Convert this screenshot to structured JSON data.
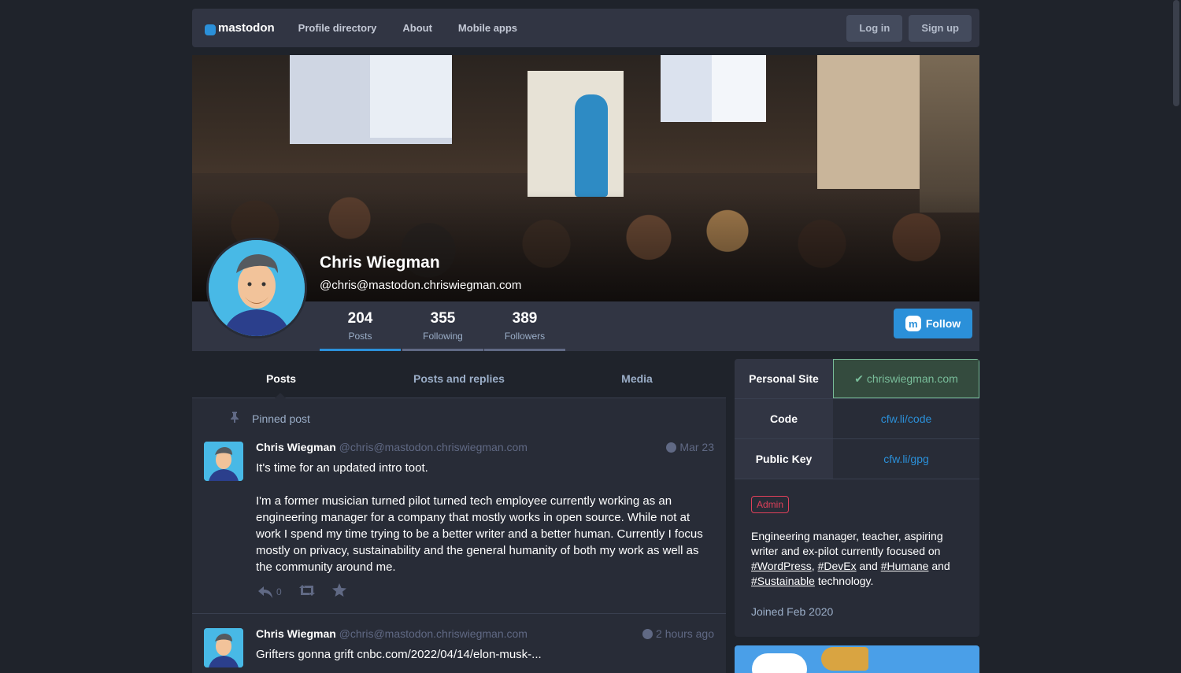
{
  "topbar": {
    "brand": "mastodon",
    "nav": [
      "Profile directory",
      "About",
      "Mobile apps"
    ],
    "login_label": "Log in",
    "signup_label": "Sign up"
  },
  "profile": {
    "name": "Chris Wiegman",
    "handle": "@chris@mastodon.chriswiegman.com",
    "stats": [
      {
        "value": "204",
        "label": "Posts",
        "active": true
      },
      {
        "value": "355",
        "label": "Following",
        "active": false
      },
      {
        "value": "389",
        "label": "Followers",
        "active": false
      }
    ],
    "follow_label": "Follow"
  },
  "tabs": [
    "Posts",
    "Posts and replies",
    "Media"
  ],
  "timeline": {
    "pinned_label": "Pinned post",
    "statuses": [
      {
        "author": "Chris Wiegman",
        "acct": "@chris@mastodon.chriswiegman.com",
        "time": "Mar 23",
        "text1": "It's time for an updated intro toot.",
        "text2": "I'm a former musician turned pilot turned tech employee currently working as an engineering manager for a company that mostly works in open source. While not at work I spend my time trying to be a better writer and a better human. Currently I focus mostly on privacy, sustainability and the general humanity of both my work as well as the community around me.",
        "reply_count": "0"
      },
      {
        "author": "Chris Wiegman",
        "acct": "@chris@mastodon.chriswiegman.com",
        "time": "2 hours ago",
        "text1": "Grifters gonna grift cnbc.com/2022/04/14/elon-musk-..."
      }
    ]
  },
  "sidebar": {
    "fields": [
      {
        "key": "Personal Site",
        "value": "✔ chriswiegman.com",
        "verified": true
      },
      {
        "key": "Code",
        "value": "cfw.li/code",
        "verified": false
      },
      {
        "key": "Public Key",
        "value": "cfw.li/gpg",
        "verified": false
      }
    ],
    "badge": "Admin",
    "bio": {
      "intro": "Engineering manager, teacher, aspiring writer and ex-pilot currently focused on",
      "tag1": "#WordPress",
      "sep1": ",",
      "tag2": "#DevEx",
      "and1": "and",
      "tag3": "#Humane",
      "and2": "and",
      "tag4": "#Sustainable",
      "outro": "technology."
    },
    "joined": "Joined Feb 2020"
  },
  "icons": {
    "pin": "pin-icon",
    "reply": "reply-icon",
    "boost": "boost-icon",
    "favourite": "star-icon",
    "globe": "globe-icon"
  },
  "colors": {
    "accent": "#2b90d9",
    "background": "#1f232b",
    "panel": "#282c37",
    "verified": "#79bd9a",
    "admin": "#df405a"
  }
}
